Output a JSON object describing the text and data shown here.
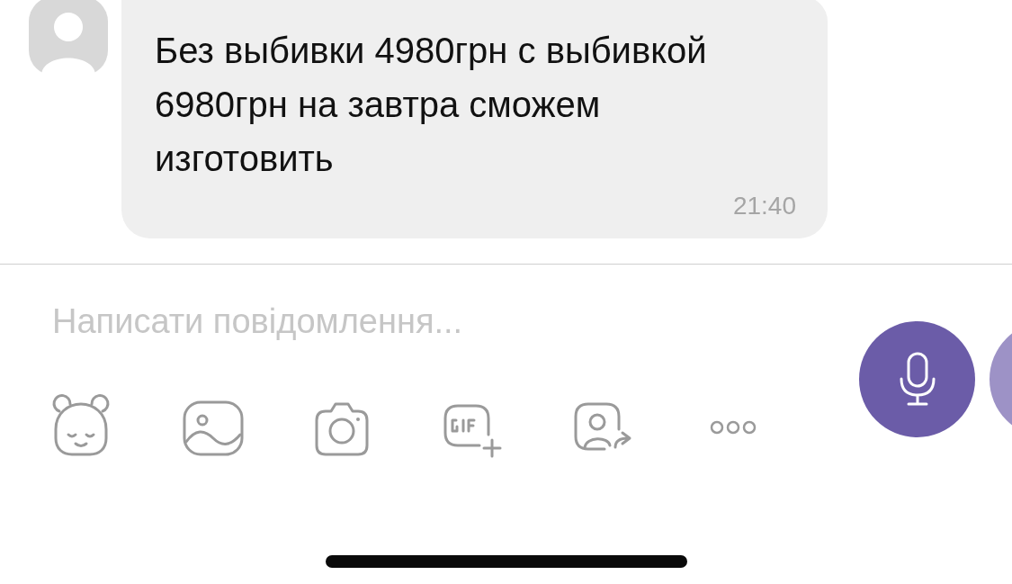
{
  "message": {
    "text": "Без выбивки 4980грн с выбивкой 6980грн на завтра сможем изготовить",
    "time": "21:40"
  },
  "composer": {
    "placeholder": "Написати повідомлення..."
  }
}
